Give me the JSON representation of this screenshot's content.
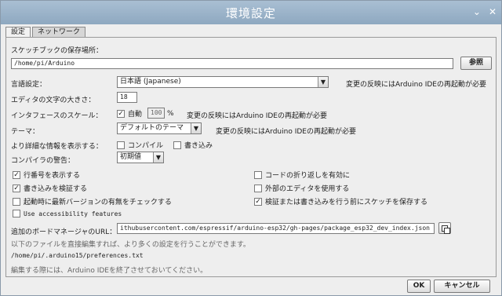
{
  "window": {
    "title": "環境設定",
    "icons": {
      "down": "⌄",
      "max": "✕"
    }
  },
  "tabs": [
    {
      "label": "設定"
    },
    {
      "label": "ネットワーク"
    }
  ],
  "sketchbook": {
    "label": "スケッチブックの保存場所：",
    "path": "/home/pi/Arduino",
    "browse": "参照"
  },
  "language": {
    "label": "言語設定：",
    "value": "日本語 (Japanese)",
    "note": "変更の反映にはArduino IDEの再起動が必要"
  },
  "font_size": {
    "label": "エディタの文字の大きさ：",
    "value": "18"
  },
  "scale": {
    "label": "インタフェースのスケール：",
    "auto": "自動",
    "percent": "100",
    "percent_sign": "%",
    "note": "変更の反映にはArduino IDEの再起動が必要"
  },
  "theme": {
    "label": "テーマ：",
    "value": "デフォルトのテーマ",
    "note": "変更の反映にはArduino IDEの再起動が必要"
  },
  "verbose": {
    "label": "より詳細な情報を表示する：",
    "compile": "コンパイル",
    "upload": "書き込み"
  },
  "warnings": {
    "label": "コンパイラの警告：",
    "value": "初期値"
  },
  "options": {
    "line_numbers": "行番号を表示する",
    "verify_upload": "書き込みを検証する",
    "check_updates": "起動時に最新バージョンの有無をチェックする",
    "accessibility": "Use accessibility features",
    "code_folding": "コードの折り返しを有効に",
    "external_editor": "外部のエディタを使用する",
    "save_on_verify": "検証または書き込みを行う前にスケッチを保存する"
  },
  "board_manager": {
    "label": "追加のボードマネージャのURL：",
    "url": "ithubusercontent.com/espressif/arduino-esp32/gh-pages/package_esp32_dev_index.json"
  },
  "info": {
    "more": "以下のファイルを直接編集すれば、より多くの設定を行うことができます。",
    "path": "/home/pi/.arduino15/preferences.txt",
    "edit_note": "編集する際には、Arduino IDEを終了させておいてください。"
  },
  "buttons": {
    "ok": "OK",
    "cancel": "キャンセル"
  }
}
